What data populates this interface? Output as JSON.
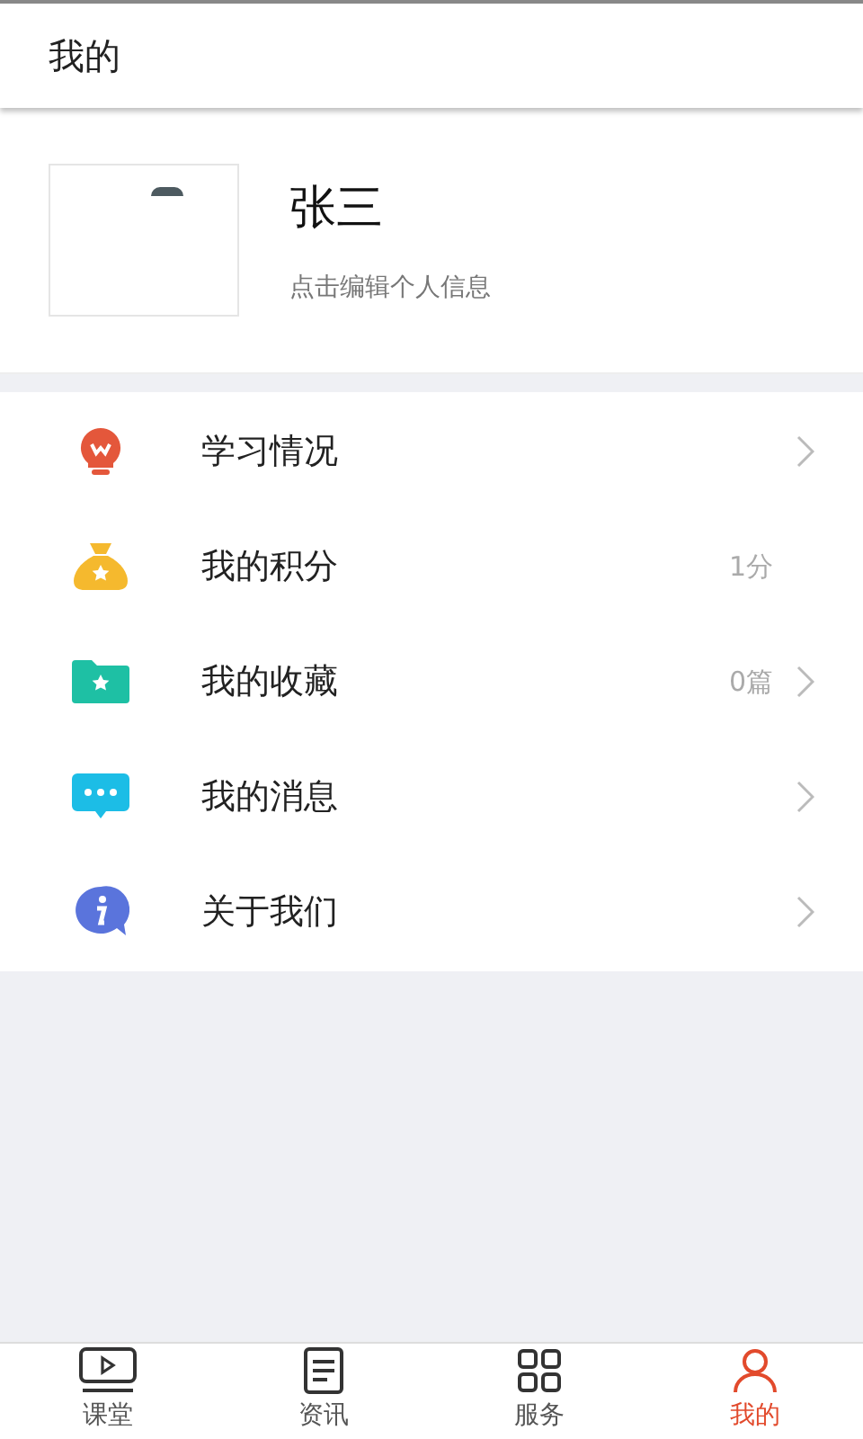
{
  "header": {
    "title": "我的"
  },
  "profile": {
    "name": "张三",
    "hint": "点击编辑个人信息"
  },
  "menu": [
    {
      "kind": "study",
      "label": "学习情况",
      "chevron": true
    },
    {
      "kind": "points",
      "label": "我的积分",
      "value": "1分",
      "chevron": false
    },
    {
      "kind": "favorites",
      "label": "我的收藏",
      "value": "0篇",
      "chevron": true
    },
    {
      "kind": "messages",
      "label": "我的消息",
      "chevron": true
    },
    {
      "kind": "about",
      "label": "关于我们",
      "chevron": true
    }
  ],
  "tabs": [
    {
      "kind": "class",
      "label": "课堂",
      "selected": false
    },
    {
      "kind": "news",
      "label": "资讯",
      "selected": false
    },
    {
      "kind": "service",
      "label": "服务",
      "selected": false
    },
    {
      "kind": "mine",
      "label": "我的",
      "selected": true
    }
  ]
}
